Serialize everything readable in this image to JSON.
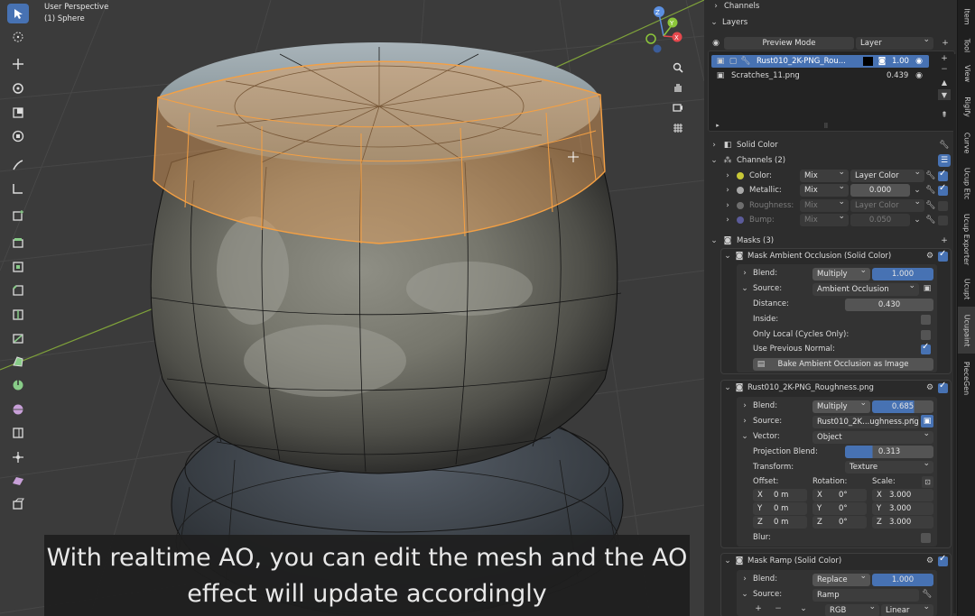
{
  "viewport": {
    "info_line1": "User Perspective",
    "info_line2": "(1) Sphere",
    "subtitle_line1": "With realtime AO, you can edit the mesh and the AO",
    "subtitle_line2": "effect will update accordingly",
    "gizmo": {
      "x": "X",
      "y": "Y",
      "z": "Z"
    },
    "tools": [
      "select-icon",
      "cursor-icon",
      "move-icon",
      "rotate-icon",
      "scale-icon",
      "transform-icon",
      "annotate-icon",
      "measure-icon",
      "add-cube-icon",
      "extrude-icon",
      "inset-icon",
      "bevel-icon",
      "loop-cut-icon",
      "knife-icon",
      "poly-build-icon",
      "spin-icon",
      "smooth-icon",
      "edge-slide-icon",
      "shrink-icon",
      "shear-icon",
      "rip-icon"
    ],
    "nav": [
      "zoom-icon",
      "hand-icon",
      "camera-icon",
      "grid-icon"
    ]
  },
  "panel": {
    "channels_header": "Channels",
    "layers_header": "Layers",
    "preview_mode_label": "Preview Mode",
    "layer_select": "Layer",
    "layers": [
      {
        "name": "Rust010_2K-PNG_Rou...",
        "value": "1.00",
        "selected": true
      },
      {
        "name": "Scratches_11.png",
        "value": "0.439",
        "selected": false
      }
    ],
    "solid_color_label": "Solid Color",
    "channels_label": "Channels (2)",
    "channel_rows": [
      {
        "name": "Color:",
        "blend": "Mix",
        "value": "Layer Color",
        "dot": "#c8c837",
        "enabled": true
      },
      {
        "name": "Metallic:",
        "blend": "Mix",
        "value": "0.000",
        "dot": "#a8a8a8",
        "enabled": true
      },
      {
        "name": "Roughness:",
        "blend": "Mix",
        "value": "Layer Color",
        "dot": "#6e6e6e",
        "enabled": false
      },
      {
        "name": "Bump:",
        "blend": "Mix",
        "value": "0.050",
        "dot": "#5b5b9a",
        "enabled": false
      }
    ],
    "masks_label": "Masks (3)",
    "mask1": {
      "title": "Mask Ambient Occlusion (Solid Color)",
      "blend_label": "Blend:",
      "blend_mode": "Multiply",
      "blend_value": "1.000",
      "source_label": "Source:",
      "source_value": "Ambient Occlusion",
      "distance_label": "Distance:",
      "distance_value": "0.430",
      "inside_label": "Inside:",
      "only_local_label": "Only Local (Cycles Only):",
      "use_prev_label": "Use Previous Normal:",
      "bake_label": "Bake Ambient Occlusion as Image"
    },
    "mask2": {
      "title": "Rust010_2K-PNG_Roughness.png",
      "blend_label": "Blend:",
      "blend_mode": "Multiply",
      "blend_value": "0.685",
      "source_label": "Source:",
      "source_value": "Rust010_2K...ughness.png",
      "vector_label": "Vector:",
      "vector_value": "Object",
      "proj_label": "Projection Blend:",
      "proj_value": "0.313",
      "transform_label": "Transform:",
      "transform_value": "Texture",
      "offset_label": "Offset:",
      "rotation_label": "Rotation:",
      "scale_label": "Scale:",
      "offset": [
        {
          "axis": "X",
          "val": "0 m"
        },
        {
          "axis": "Y",
          "val": "0 m"
        },
        {
          "axis": "Z",
          "val": "0 m"
        }
      ],
      "rotation": [
        {
          "axis": "X",
          "val": "0°"
        },
        {
          "axis": "Y",
          "val": "0°"
        },
        {
          "axis": "Z",
          "val": "0°"
        }
      ],
      "scale": [
        {
          "axis": "X",
          "val": "3.000"
        },
        {
          "axis": "Y",
          "val": "3.000"
        },
        {
          "axis": "Z",
          "val": "3.000"
        }
      ],
      "blur_label": "Blur:"
    },
    "mask3": {
      "title": "Mask Ramp (Solid Color)",
      "blend_label": "Blend:",
      "blend_mode": "Replace",
      "blend_value": "1.000",
      "source_label": "Source:",
      "source_value": "Ramp",
      "ramp_mode": "RGB",
      "ramp_interp": "Linear"
    }
  },
  "sidebar_tabs": [
    "Item",
    "Tool",
    "View",
    "Rigify",
    "Curve",
    "Ucup Etc",
    "Ucup Exporter",
    "Ucupt",
    "Ucupaint",
    "PieceGen"
  ],
  "accent_color": "#4772b3"
}
